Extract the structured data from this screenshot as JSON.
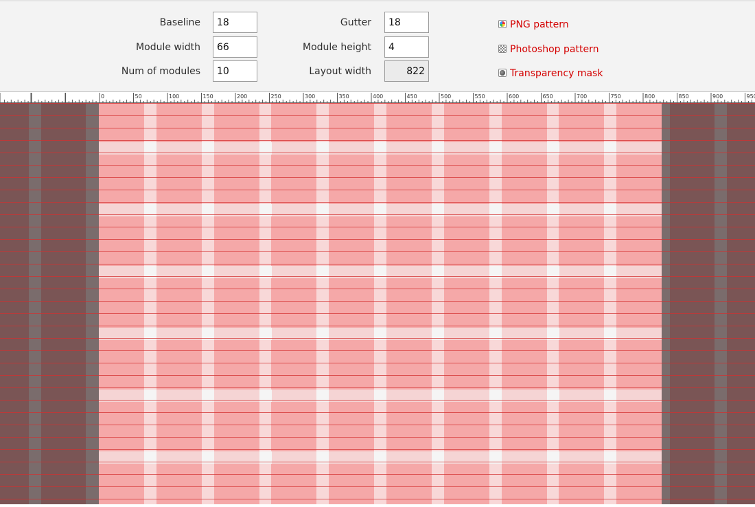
{
  "controls": {
    "baseline": {
      "label": "Baseline",
      "value": "18"
    },
    "module_width": {
      "label": "Module width",
      "value": "66"
    },
    "num_modules": {
      "label": "Num of modules",
      "value": "10"
    },
    "gutter": {
      "label": "Gutter",
      "value": "18"
    },
    "module_height": {
      "label": "Module height",
      "value": "4"
    },
    "layout_width": {
      "label": "Layout width",
      "value": "822"
    }
  },
  "downloads": [
    {
      "label": "PNG pattern",
      "icon": "png-icon"
    },
    {
      "label": "Photoshop pattern",
      "icon": "photoshop-pattern-icon"
    },
    {
      "label": "Transparency mask",
      "icon": "transparency-mask-icon"
    }
  ],
  "ruler": {
    "labels": [
      "0",
      "50",
      "100",
      "150",
      "200",
      "250",
      "300",
      "350",
      "400",
      "450",
      "500",
      "550",
      "600",
      "650",
      "700",
      "750",
      "800",
      "850",
      "900",
      "950"
    ]
  },
  "colors": {
    "link": "#d40000",
    "module": "#f5a8a8",
    "gutter": "#f8d8d8",
    "row_gap": "#f5d4d4",
    "intersection": "#f5f5f5",
    "outside": "#7a5555",
    "outside_gutter": "#7a6c6c",
    "baseline_line": "#d33030"
  }
}
